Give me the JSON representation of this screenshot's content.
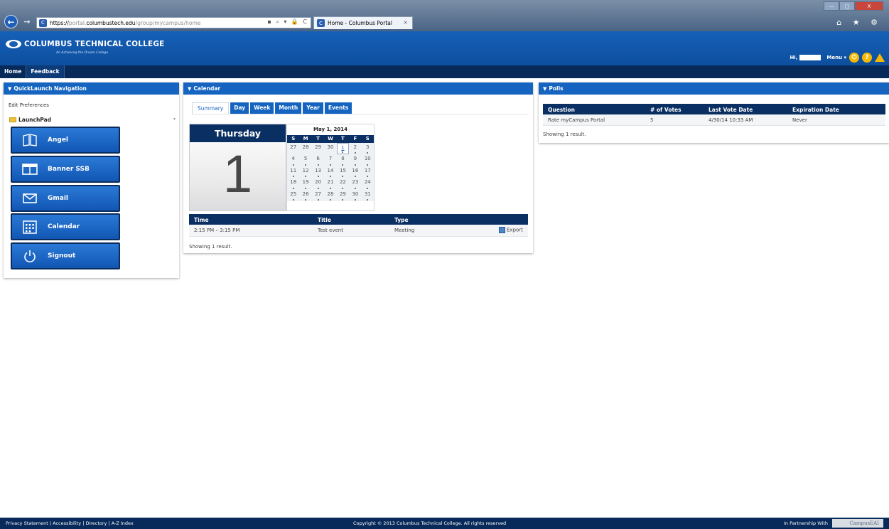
{
  "browser": {
    "url_prefix": "https://",
    "url_sub": "portal.",
    "url_host": "columbustech.edu",
    "url_path": "/group/mycampus/home",
    "address_tools": "▪ ⌕ ▾ 🔒 C",
    "tab_title": "Home - Columbus Portal",
    "tab_close": "×",
    "back": "←",
    "forward": "→",
    "toolbar_icons": "⌂ ★ ⚙",
    "win_min": "—",
    "win_max": "□",
    "win_close": "X"
  },
  "header": {
    "logo_text": "COLUMBUS TECHNICAL COLLEGE",
    "tagline": "An Achieving the Dream College",
    "greeting": "Hi,",
    "menu_label": "Menu ▾",
    "power_glyph": "⏻",
    "help_glyph": "?"
  },
  "nav": {
    "items": [
      "Home",
      "Feedback"
    ]
  },
  "quicklaunch": {
    "title": "QuickLaunch Navigation",
    "edit_prefs": "Edit Preferences",
    "launchpad": "LaunchPad",
    "launchpad_caret": "▾",
    "buttons": [
      {
        "label": "Angel",
        "icon": "book-icon"
      },
      {
        "label": "Banner SSB",
        "icon": "window-icon"
      },
      {
        "label": "Gmail",
        "icon": "envelope-icon"
      },
      {
        "label": "Calendar",
        "icon": "calendar-icon"
      },
      {
        "label": "Signout",
        "icon": "power-icon"
      }
    ]
  },
  "calendar": {
    "title": "Calendar",
    "tabs": [
      "Summary",
      "Day",
      "Week",
      "Month",
      "Year",
      "Events"
    ],
    "day_name": "Thursday",
    "day_number": "1",
    "month_title": "May 1, 2014",
    "dow": [
      "S",
      "M",
      "T",
      "W",
      "T",
      "F",
      "S"
    ],
    "weeks": [
      [
        "27",
        "28",
        "29",
        "30",
        "1",
        "2",
        "3"
      ],
      [
        "4",
        "5",
        "6",
        "7",
        "8",
        "9",
        "10"
      ],
      [
        "11",
        "12",
        "13",
        "14",
        "15",
        "16",
        "17"
      ],
      [
        "18",
        "19",
        "20",
        "21",
        "22",
        "23",
        "24"
      ],
      [
        "25",
        "26",
        "27",
        "28",
        "29",
        "30",
        "31"
      ]
    ],
    "today_index": 4,
    "events_columns": {
      "time": "Time",
      "title": "Title",
      "type": "Type"
    },
    "events": [
      {
        "time": "2:15 PM – 3:15 PM",
        "title": "Test event",
        "type": "Meeting",
        "action": "Export"
      }
    ],
    "result_text": "Showing 1 result."
  },
  "polls": {
    "title": "Polls",
    "columns": {
      "question": "Question",
      "votes": "# of Votes",
      "last": "Last Vote Date",
      "exp": "Expiration Date"
    },
    "rows": [
      {
        "question": "Rate myCampus Portal",
        "votes": "5",
        "last": "4/30/14 10:33 AM",
        "exp": "Never"
      }
    ],
    "result_text": "Showing 1 result."
  },
  "footer": {
    "links": "Privacy Statement | Accessibility | Directory | A-Z Index",
    "copyright": "Copyright © 2013 Columbus Technical College. All rights reserved",
    "partner": "In Partnership With",
    "partner_logo": "CampusEAI"
  },
  "colors": {
    "primary": "#1564c0",
    "navy": "#0a2f63",
    "accent": "#f5b800"
  }
}
